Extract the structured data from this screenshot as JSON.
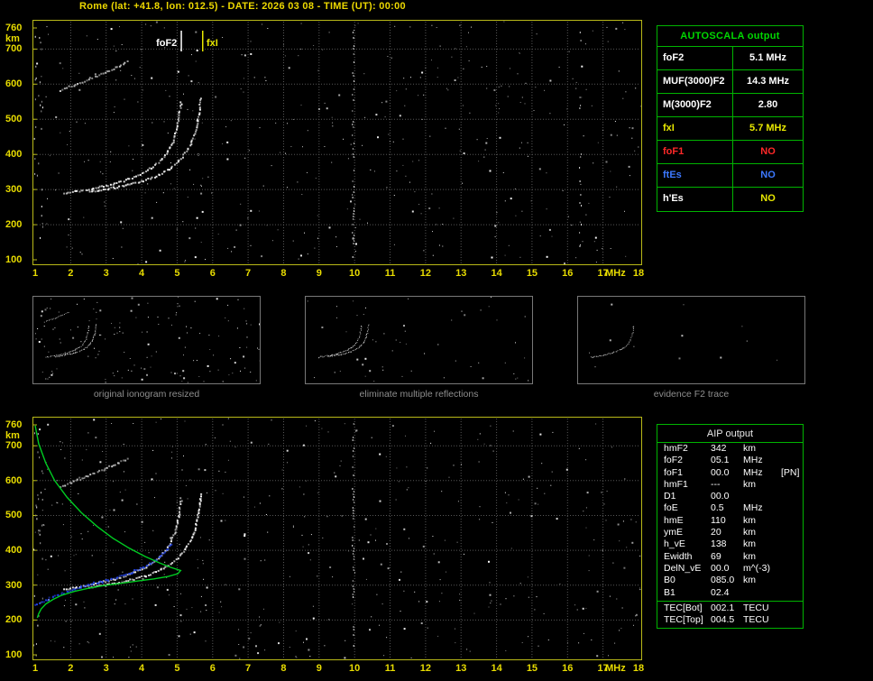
{
  "header": {
    "title": "Rome (lat: +41.8, lon: 012.5) - DATE: 2026 03 08 - TIME (UT): 00:00"
  },
  "colors": {
    "background": "#000000",
    "title_yellow": "#ecd800",
    "axis_yellow": "#e8dc00",
    "plot_border": "#b9b918",
    "grid_gray": "#565656",
    "table_green": "#00b400",
    "white": "#ffffff",
    "red": "#ff2828",
    "blue": "#3c78ff",
    "yellow": "#e8e800",
    "profile_green": "#00cc22",
    "restored_blue": "#2244ee",
    "caption_gray": "#8e8e8e"
  },
  "autoscala": {
    "title": "AUTOSCALA output",
    "rows": [
      {
        "label": "foF2",
        "value": "5.1 MHz",
        "label_color": "#ffffff",
        "value_color": "#ffffff"
      },
      {
        "label": "MUF(3000)F2",
        "value": "14.3 MHz",
        "label_color": "#ffffff",
        "value_color": "#ffffff"
      },
      {
        "label": "M(3000)F2",
        "value": "2.80",
        "label_color": "#ffffff",
        "value_color": "#ffffff"
      },
      {
        "label": "fxI",
        "value": "5.7 MHz",
        "label_color": "#e8e800",
        "value_color": "#e8e800"
      },
      {
        "label": "foF1",
        "value": "NO",
        "label_color": "#ff2828",
        "value_color": "#ff2828"
      },
      {
        "label": "ftEs",
        "value": "NO",
        "label_color": "#3c78ff",
        "value_color": "#3c78ff"
      },
      {
        "label": "h'Es",
        "value": "NO",
        "label_color": "#ffffff",
        "value_color": "#e8e800"
      }
    ]
  },
  "thumbnails": [
    {
      "caption": "original ionogram resized"
    },
    {
      "caption": "eliminate multiple reflections"
    },
    {
      "caption": "evidence F2 trace"
    }
  ],
  "aip": {
    "title": "AIP output",
    "rows": [
      {
        "name": "hmF2",
        "value": "342",
        "unit": "km",
        "extra": ""
      },
      {
        "name": "foF2",
        "value": "05.1",
        "unit": "MHz",
        "extra": ""
      },
      {
        "name": "foF1",
        "value": "00.0",
        "unit": "MHz",
        "extra": "[PN]"
      },
      {
        "name": "hmF1",
        "value": "---",
        "unit": "km",
        "extra": ""
      },
      {
        "name": "D1",
        "value": "00.0",
        "unit": "",
        "extra": ""
      },
      {
        "name": "foE",
        "value": "0.5",
        "unit": "MHz",
        "extra": ""
      },
      {
        "name": "hmE",
        "value": "110",
        "unit": "km",
        "extra": ""
      },
      {
        "name": "ymE",
        "value": "20",
        "unit": "km",
        "extra": ""
      },
      {
        "name": "h_vE",
        "value": "138",
        "unit": "km",
        "extra": ""
      },
      {
        "name": "Ewidth",
        "value": "69",
        "unit": "km",
        "extra": ""
      },
      {
        "name": "DelN_vE",
        "value": "00.0",
        "unit": "m^(-3)",
        "extra": ""
      },
      {
        "name": "B0",
        "value": "085.0",
        "unit": "km",
        "extra": ""
      },
      {
        "name": "B1",
        "value": "02.4",
        "unit": "",
        "extra": ""
      }
    ],
    "tec_rows": [
      {
        "name": "TEC[Bot]",
        "value": "002.1",
        "unit": "TECU",
        "extra": ""
      },
      {
        "name": "TEC[Top]",
        "value": "004.5",
        "unit": "TECU",
        "extra": ""
      }
    ]
  },
  "chart_data": [
    {
      "id": "ionogram_top",
      "type": "scatter",
      "title": "recorded ionogram with autoscaled characteristics",
      "xlabel": "MHz",
      "ylabel": "km",
      "xlim": [
        1,
        18
      ],
      "ylim": [
        100,
        760
      ],
      "x_ticks": [
        1,
        2,
        3,
        4,
        5,
        6,
        7,
        8,
        9,
        10,
        11,
        12,
        13,
        14,
        15,
        16,
        17,
        18
      ],
      "y_ticks": [
        760,
        700,
        600,
        500,
        400,
        300,
        200,
        100
      ],
      "grid": true,
      "markers": [
        {
          "label": "foF2",
          "freq": 5.1,
          "color": "#ffffff",
          "label_side": "left"
        },
        {
          "label": "fxI",
          "freq": 5.7,
          "color": "#e8e800",
          "label_side": "right"
        }
      ],
      "traces": [
        {
          "name": "F2 trace ordinary",
          "color": "#ffffff",
          "points": [
            [
              1.8,
              290
            ],
            [
              2.1,
              296
            ],
            [
              2.45,
              302
            ],
            [
              2.8,
              309
            ],
            [
              3.1,
              316
            ],
            [
              3.4,
              325
            ],
            [
              3.7,
              336
            ],
            [
              4.0,
              349
            ],
            [
              4.25,
              364
            ],
            [
              4.5,
              383
            ],
            [
              4.68,
              404
            ],
            [
              4.82,
              428
            ],
            [
              4.92,
              455
            ],
            [
              4.99,
              484
            ],
            [
              5.04,
              513
            ],
            [
              5.08,
              540
            ],
            [
              5.1,
              558
            ]
          ]
        },
        {
          "name": "F2 trace extraordinary",
          "color": "#ffffff",
          "points": [
            [
              2.5,
              296
            ],
            [
              2.9,
              302
            ],
            [
              3.3,
              309
            ],
            [
              3.7,
              318
            ],
            [
              4.1,
              329
            ],
            [
              4.45,
              343
            ],
            [
              4.75,
              360
            ],
            [
              5.0,
              381
            ],
            [
              5.2,
              405
            ],
            [
              5.36,
              432
            ],
            [
              5.47,
              461
            ],
            [
              5.55,
              492
            ],
            [
              5.6,
              522
            ],
            [
              5.63,
              550
            ],
            [
              5.65,
              568
            ]
          ]
        },
        {
          "name": "second reflection",
          "color": "#c8c8c8",
          "points": [
            [
              1.7,
              585
            ],
            [
              2.0,
              597
            ],
            [
              2.3,
              609
            ],
            [
              2.6,
              621
            ],
            [
              2.9,
              634
            ],
            [
              3.2,
              647
            ],
            [
              3.45,
              659
            ],
            [
              3.62,
              669
            ]
          ]
        }
      ],
      "noise": {
        "seed": 11,
        "count": 430
      },
      "rfi_columns": [
        {
          "freq": 9.95,
          "density": 0.45
        },
        {
          "freq": 16.35,
          "density": 0.18
        }
      ]
    },
    {
      "id": "ionogram_bottom",
      "type": "scatter",
      "title": "ionogram with restored trace and electron density profile",
      "xlabel": "MHz",
      "ylabel": "km",
      "xlim": [
        1,
        18
      ],
      "ylim": [
        100,
        760
      ],
      "x_ticks": [
        1,
        2,
        3,
        4,
        5,
        6,
        7,
        8,
        9,
        10,
        11,
        12,
        13,
        14,
        15,
        16,
        17,
        18
      ],
      "y_ticks": [
        760,
        700,
        600,
        500,
        400,
        300,
        200,
        100
      ],
      "grid": true,
      "traces": [
        {
          "name": "F2 trace ordinary",
          "color": "#ffffff",
          "points": [
            [
              1.8,
              290
            ],
            [
              2.1,
              296
            ],
            [
              2.45,
              302
            ],
            [
              2.8,
              309
            ],
            [
              3.1,
              316
            ],
            [
              3.4,
              325
            ],
            [
              3.7,
              336
            ],
            [
              4.0,
              349
            ],
            [
              4.25,
              364
            ],
            [
              4.5,
              383
            ],
            [
              4.68,
              404
            ],
            [
              4.82,
              428
            ],
            [
              4.92,
              455
            ],
            [
              4.99,
              484
            ],
            [
              5.04,
              513
            ],
            [
              5.08,
              540
            ],
            [
              5.1,
              558
            ]
          ]
        },
        {
          "name": "F2 trace extraordinary",
          "color": "#ffffff",
          "points": [
            [
              2.5,
              296
            ],
            [
              2.9,
              302
            ],
            [
              3.3,
              309
            ],
            [
              3.7,
              318
            ],
            [
              4.1,
              329
            ],
            [
              4.45,
              343
            ],
            [
              4.75,
              360
            ],
            [
              5.0,
              381
            ],
            [
              5.2,
              405
            ],
            [
              5.36,
              432
            ],
            [
              5.47,
              461
            ],
            [
              5.55,
              492
            ],
            [
              5.6,
              522
            ],
            [
              5.63,
              550
            ],
            [
              5.65,
              568
            ]
          ]
        },
        {
          "name": "second reflection",
          "color": "#c8c8c8",
          "points": [
            [
              1.7,
              585
            ],
            [
              2.0,
              597
            ],
            [
              2.3,
              609
            ],
            [
              2.6,
              621
            ],
            [
              2.9,
              634
            ],
            [
              3.2,
              647
            ],
            [
              3.45,
              659
            ],
            [
              3.62,
              669
            ]
          ]
        }
      ],
      "restored_trace": {
        "name": "restored F2 trace",
        "color": "#2244ee",
        "points": [
          [
            1.0,
            246
          ],
          [
            1.3,
            260
          ],
          [
            1.6,
            273
          ],
          [
            1.9,
            284
          ],
          [
            2.2,
            294
          ],
          [
            2.5,
            303
          ],
          [
            2.8,
            311
          ],
          [
            3.1,
            319
          ],
          [
            3.4,
            328
          ],
          [
            3.7,
            339
          ],
          [
            4.0,
            352
          ],
          [
            4.25,
            366
          ],
          [
            4.5,
            384
          ],
          [
            4.68,
            404
          ],
          [
            4.82,
            426
          ]
        ]
      },
      "profile": {
        "name": "electron density profile",
        "color": "#00cc22",
        "points": [
          [
            1.0,
            758
          ],
          [
            1.1,
            706
          ],
          [
            1.3,
            650
          ],
          [
            1.55,
            600
          ],
          [
            1.9,
            552
          ],
          [
            2.3,
            508
          ],
          [
            2.75,
            468
          ],
          [
            3.2,
            434
          ],
          [
            3.65,
            406
          ],
          [
            4.1,
            382
          ],
          [
            4.5,
            364
          ],
          [
            4.82,
            351
          ],
          [
            5.03,
            344
          ],
          [
            5.1,
            342
          ],
          [
            5.02,
            333
          ],
          [
            4.75,
            325
          ],
          [
            4.35,
            318
          ],
          [
            3.9,
            312
          ],
          [
            3.4,
            305
          ],
          [
            2.95,
            299
          ],
          [
            2.5,
            291
          ],
          [
            2.1,
            282
          ],
          [
            1.75,
            271
          ],
          [
            1.5,
            259
          ],
          [
            1.3,
            246
          ],
          [
            1.17,
            232
          ],
          [
            1.1,
            218
          ],
          [
            1.06,
            206
          ]
        ]
      },
      "noise": {
        "seed": 29,
        "count": 430
      },
      "rfi_columns": [
        {
          "freq": 9.95,
          "density": 0.4
        }
      ]
    }
  ]
}
